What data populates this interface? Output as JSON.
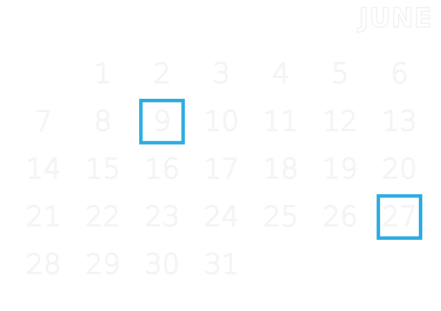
{
  "calendar": {
    "month": "JUNE",
    "highlight_color": "#29abe2",
    "highlighted_days": [
      "9",
      "27"
    ],
    "days": [
      "",
      "1",
      "2",
      "3",
      "4",
      "5",
      "6",
      "7",
      "8",
      "9",
      "10",
      "11",
      "12",
      "13",
      "14",
      "15",
      "16",
      "17",
      "18",
      "19",
      "20",
      "21",
      "22",
      "23",
      "24",
      "25",
      "26",
      "27",
      "28",
      "29",
      "30",
      "31",
      "",
      "",
      ""
    ]
  }
}
